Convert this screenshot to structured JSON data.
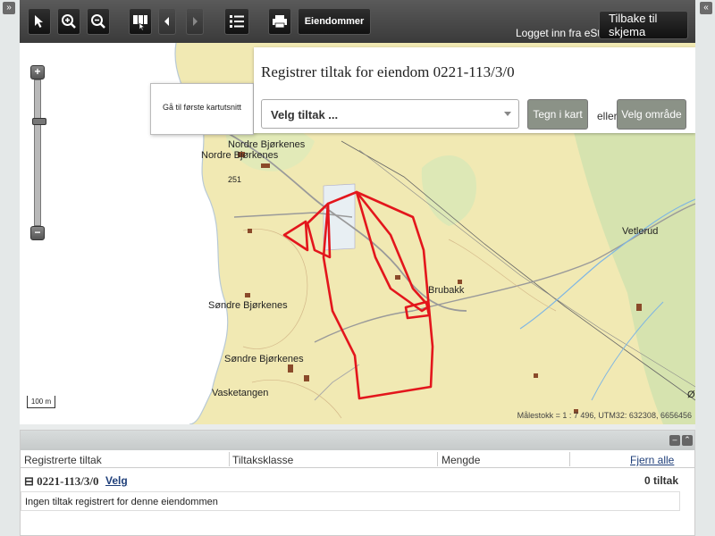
{
  "corner": {
    "left_glyph": "»",
    "right_glyph": "«"
  },
  "toolbar": {
    "icons": [
      "cursor-arrow-icon",
      "zoom-in-icon",
      "zoom-out-icon",
      "map-pages-icon",
      "prev-arrow-icon",
      "next-arrow-icon",
      "list-icon",
      "print-icon"
    ],
    "eiendommer_label": "Eiendommer",
    "logged_in_text": "Logget inn fra eStil",
    "tilbake_label": "Tilbake til skjema"
  },
  "tooltip": {
    "text": "Gå til første kartutsnitt"
  },
  "zoom": {
    "plus": "+",
    "minus": "−",
    "level_fraction": 0.27
  },
  "panel": {
    "title": "Registrer tiltak for eiendom 0221-113/3/0",
    "select_value": "Velg tiltak ...",
    "tegn_label": "Tegn i kart",
    "eller_text": "eller",
    "velg_omrade_label": "Velg område"
  },
  "map": {
    "labels": [
      "Nordre Bjørkenes",
      "Nordre Bjørkenes",
      "Søndre Bjørkenes",
      "Søndre Bjørkenes",
      "Vasketangen",
      "Brubakk",
      "Vetlerud",
      "251",
      "Ø"
    ],
    "scalebar": "100 m",
    "coords": "Målestokk = 1 : 7 496, UTM32: 632308, 6656456",
    "colors": {
      "land": "#f1e9b3",
      "water": "#ffffff",
      "forest": "#d9e6b4",
      "boundary": "#e3161c"
    }
  },
  "bottom": {
    "columns": [
      "Registrerte tiltak",
      "Tiltaksklasse",
      "Mengde",
      "Fjern alle"
    ],
    "group": {
      "title": "0221-113/3/0",
      "velg": "Velg",
      "count": "0 tiltak"
    },
    "empty_text": "Ingen tiltak registrert for denne eiendommen"
  }
}
